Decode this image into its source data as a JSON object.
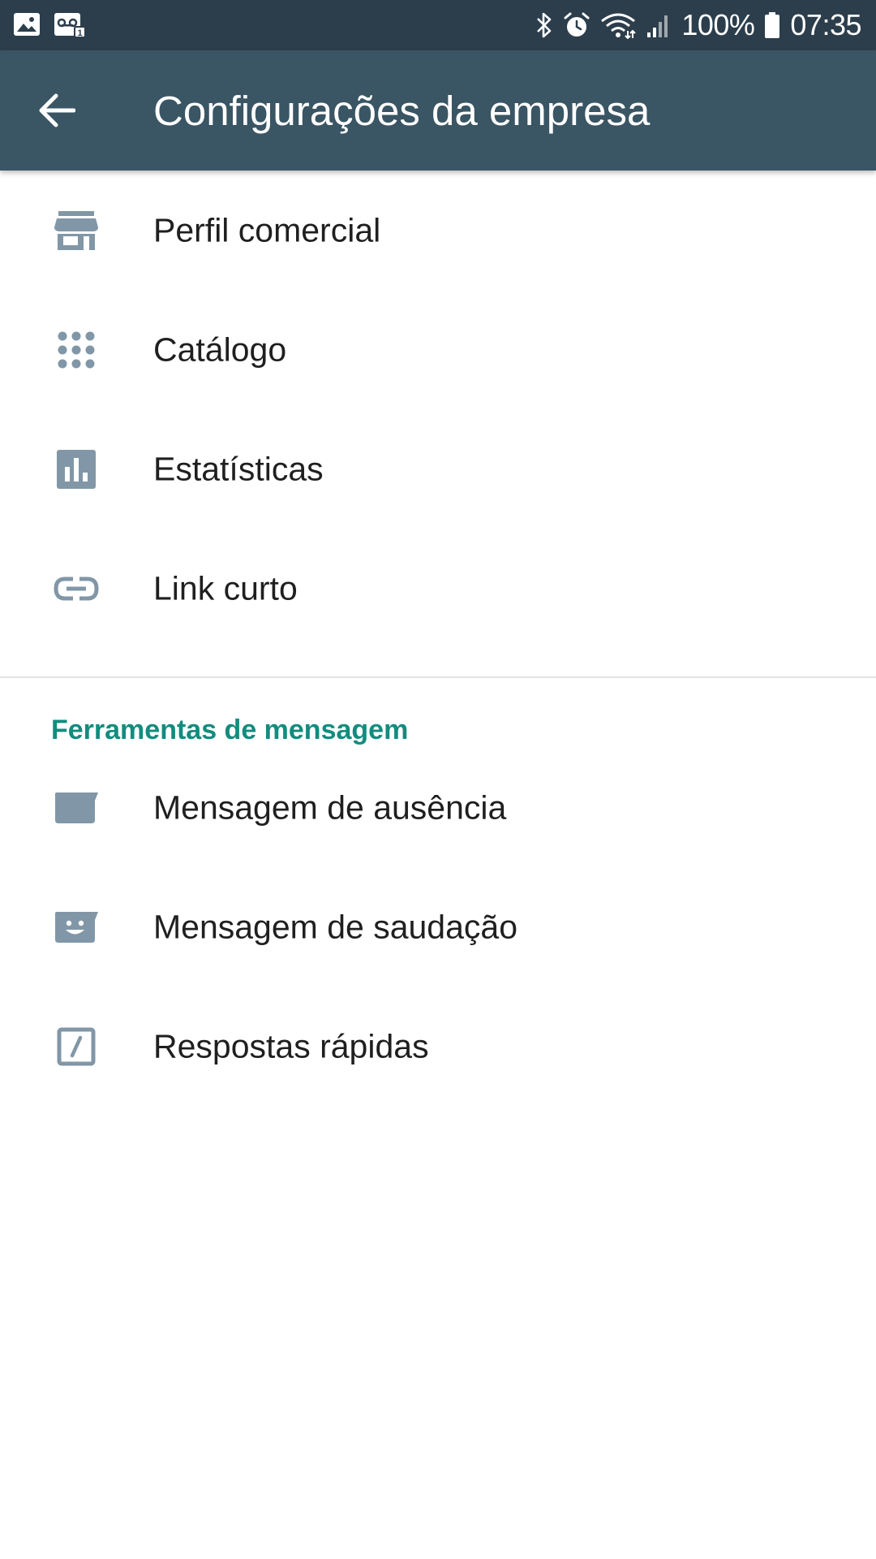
{
  "status_bar": {
    "battery": "100%",
    "time": "07:35"
  },
  "app_bar": {
    "title": "Configurações da empresa"
  },
  "menu_items": [
    {
      "label": "Perfil comercial",
      "icon": "store-icon"
    },
    {
      "label": "Catálogo",
      "icon": "grid-icon"
    },
    {
      "label": "Estatísticas",
      "icon": "bar-chart-icon"
    },
    {
      "label": "Link curto",
      "icon": "link-icon"
    }
  ],
  "section": {
    "title": "Ferramentas de mensagem",
    "items": [
      {
        "label": "Mensagem de ausência",
        "icon": "away-message-icon"
      },
      {
        "label": "Mensagem de saudação",
        "icon": "greeting-message-icon"
      },
      {
        "label": "Respostas rápidas",
        "icon": "quick-reply-icon"
      }
    ]
  },
  "colors": {
    "status_bar": "#2c3e4c",
    "app_bar": "#3a5564",
    "accent": "#128c7e",
    "icon": "#8197a7"
  }
}
